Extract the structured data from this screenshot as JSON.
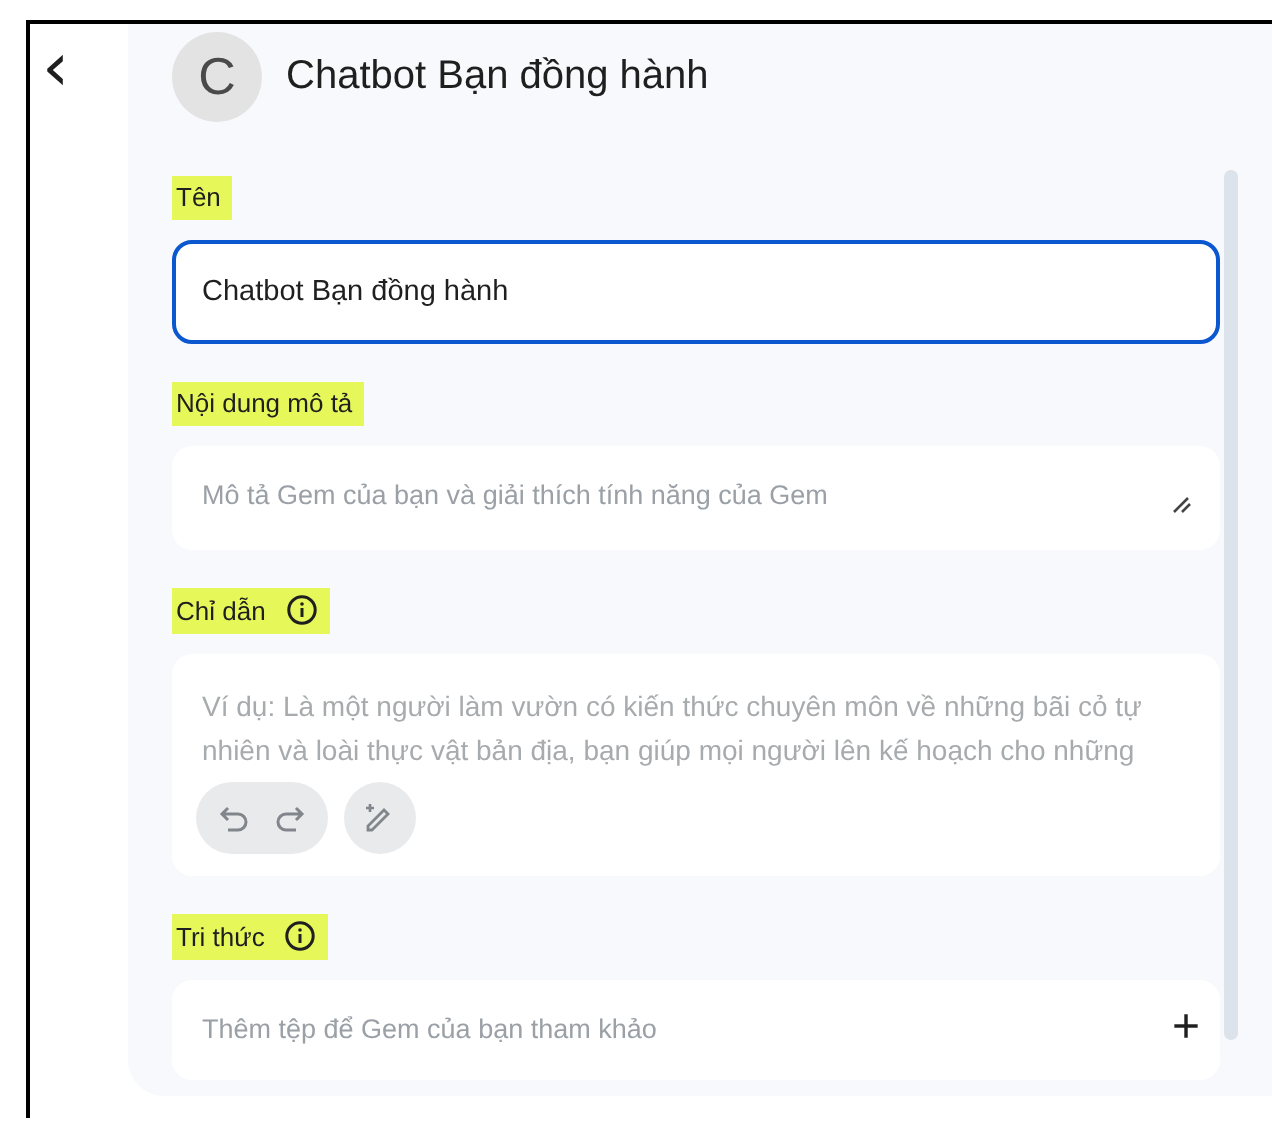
{
  "header": {
    "back_icon": "‹",
    "avatar_letter": "C",
    "title": "Chatbot Bạn đồng hành"
  },
  "sections": [
    {
      "kind": "input",
      "label": "Tên",
      "highlighted": true,
      "info": false,
      "value": "Chatbot Bạn đồng hành",
      "focused": true
    },
    {
      "kind": "textarea",
      "label": "Nội dung mô tả",
      "highlighted": true,
      "info": false,
      "placeholder": "Mô tả Gem của bạn và giải thích tính năng của Gem"
    },
    {
      "kind": "editor",
      "label": "Chỉ dẫn",
      "highlighted": true,
      "info": true,
      "placeholder": "Ví dụ: Là một người làm vườn có kiến thức chuyên môn về những bãi cỏ tự nhiên và loài thực vật bản địa, bạn giúp mọi người lên kế hoạch cho những"
    },
    {
      "kind": "files",
      "label": "Tri thức",
      "highlighted": true,
      "info": true,
      "placeholder": "Thêm tệp để Gem của bạn tham khảo",
      "add_icon": "+"
    }
  ]
}
